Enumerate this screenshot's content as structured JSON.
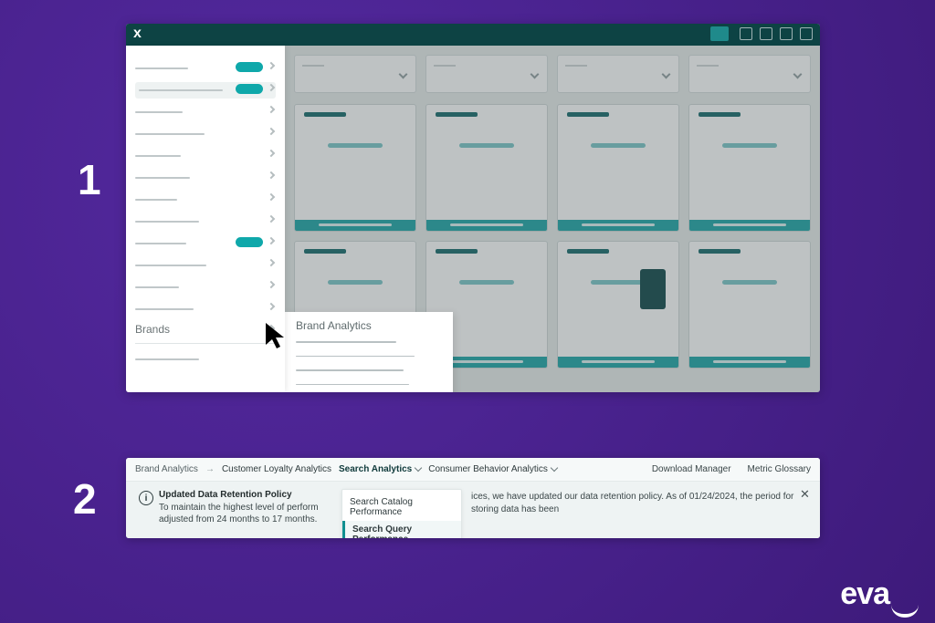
{
  "steps": {
    "one": "1",
    "two": "2"
  },
  "panel1": {
    "close_label": "x",
    "sidebar": {
      "brands_label": "Brands"
    },
    "flyout": {
      "title": "Brand Analytics"
    }
  },
  "panel2": {
    "breadcrumb": {
      "root": "Brand Analytics",
      "arrow": "→"
    },
    "tabs": {
      "loyalty": "Customer Loyalty Analytics",
      "search": "Search Analytics",
      "behavior": "Consumer Behavior Analytics"
    },
    "right_links": {
      "download": "Download Manager",
      "glossary": "Metric Glossary"
    },
    "banner": {
      "title": "Updated Data Retention Policy",
      "line1": "To maintain the highest level of perform",
      "line2": "adjusted from 24 months to 17 months.",
      "rest": "ices, we have updated our data retention policy. As of 01/24/2024, the period for storing data has been"
    },
    "dropdown": {
      "opt1": "Search Catalog Performance",
      "opt2": "Search Query Performance"
    }
  },
  "logo": {
    "text": "eva"
  }
}
